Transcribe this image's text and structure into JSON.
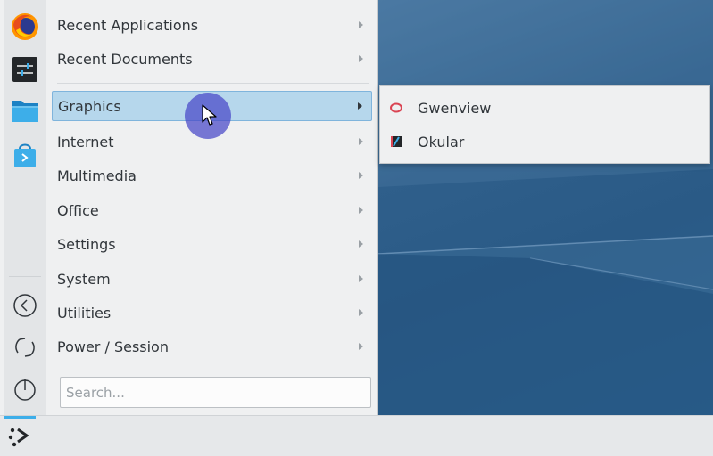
{
  "favorites": {
    "items": [
      {
        "name": "firefox",
        "icon": "firefox-icon"
      },
      {
        "name": "system-settings",
        "icon": "settings-sliders-icon"
      },
      {
        "name": "file-manager",
        "icon": "folder-icon"
      },
      {
        "name": "discover",
        "icon": "store-bag-icon"
      }
    ],
    "session": [
      {
        "name": "leave",
        "icon": "back-circle-icon"
      },
      {
        "name": "restart",
        "icon": "restart-icon"
      },
      {
        "name": "shutdown",
        "icon": "power-icon"
      }
    ]
  },
  "menu": {
    "recent": [
      {
        "label": "Recent Applications"
      },
      {
        "label": "Recent Documents"
      }
    ],
    "categories": [
      {
        "label": "Graphics",
        "active": true
      },
      {
        "label": "Internet"
      },
      {
        "label": "Multimedia"
      },
      {
        "label": "Office"
      },
      {
        "label": "Settings"
      },
      {
        "label": "System"
      },
      {
        "label": "Utilities"
      },
      {
        "label": "Power / Session"
      }
    ]
  },
  "search": {
    "placeholder": "Search...",
    "value": ""
  },
  "submenu": {
    "items": [
      {
        "label": "Gwenview",
        "icon": "gwenview-icon"
      },
      {
        "label": "Okular",
        "icon": "okular-icon"
      }
    ]
  },
  "colors": {
    "highlight": "#b6d7ec",
    "highlight_border": "#7fb4dc",
    "accent": "#3daee9",
    "text": "#31363b"
  }
}
